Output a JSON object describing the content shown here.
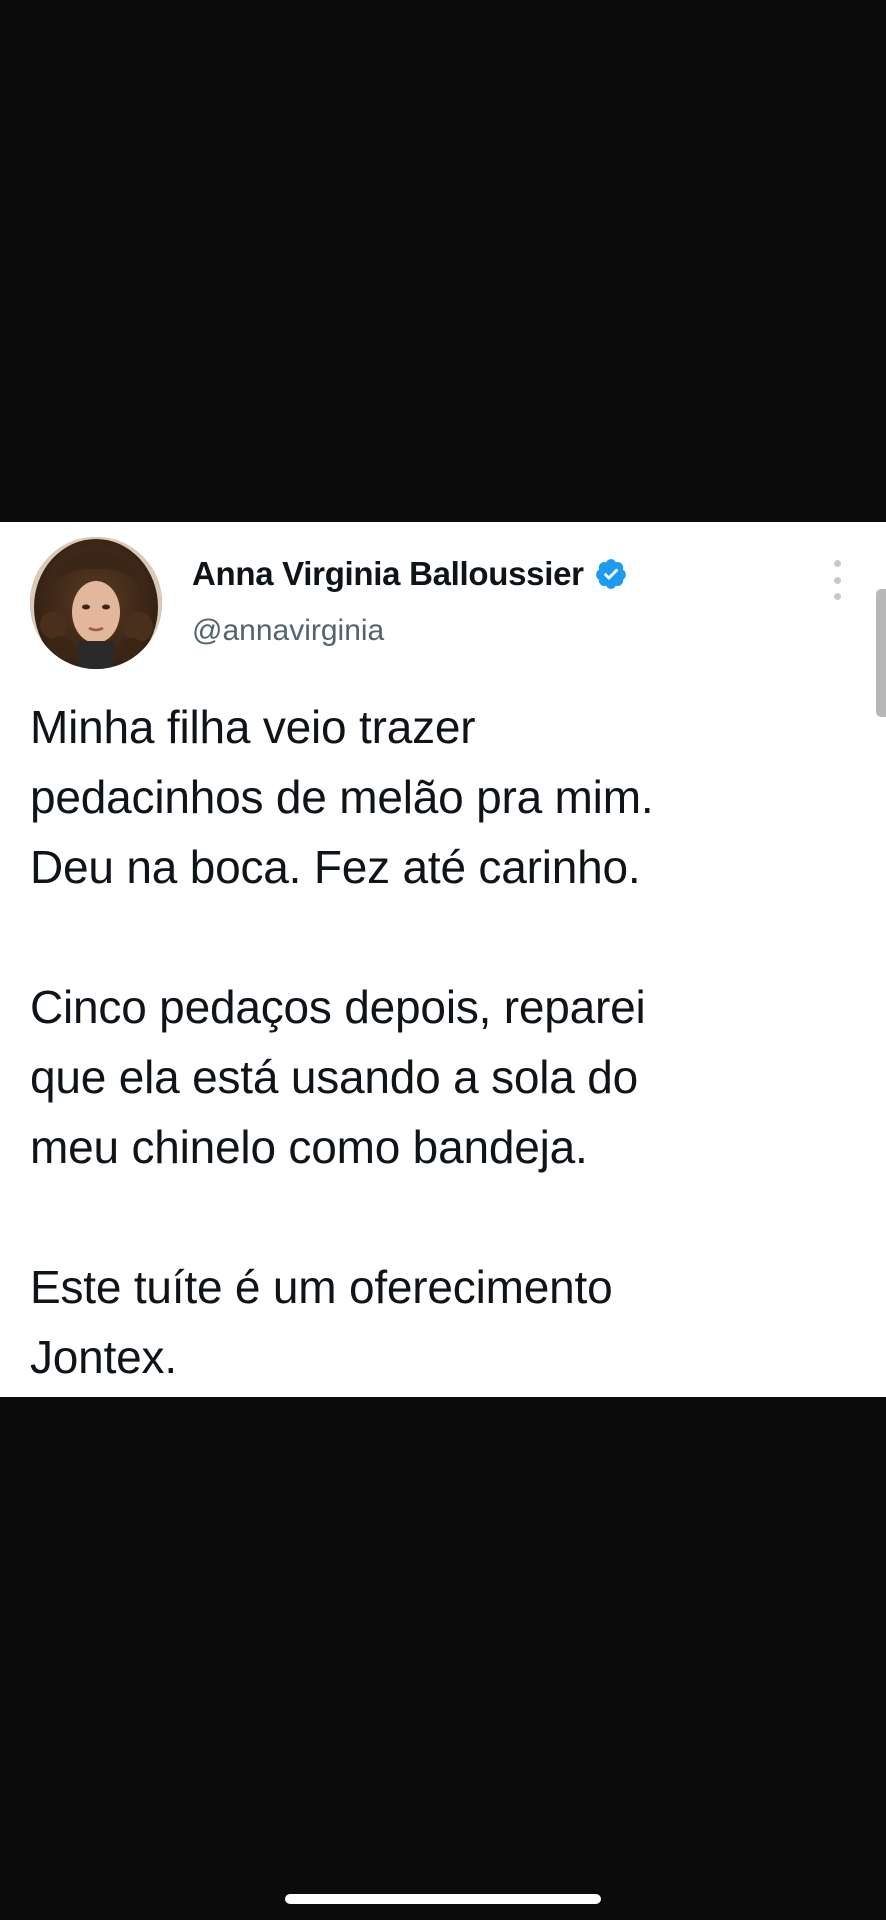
{
  "tweet": {
    "author": {
      "name": "Anna Virginia Balloussier",
      "handle": "@annavirginia",
      "verified": true,
      "avatar_icon": "profile-photo"
    },
    "body": {
      "paragraph1": [
        "Minha filha veio trazer",
        "pedacinhos de melão pra mim.",
        "Deu na boca. Fez até carinho."
      ],
      "paragraph2": [
        "Cinco pedaços depois, reparei",
        "que ela está usando a sola do",
        "meu chinelo como bandeja."
      ],
      "paragraph3": [
        "Este tuíte é um oferecimento",
        "Jontex."
      ]
    },
    "more_icon": "more-vertical-icon",
    "colors": {
      "background": "#0b0b0b",
      "card": "#ffffff",
      "text": "#0f1419",
      "handle": "#536471",
      "verified": "#1d9bf0"
    }
  }
}
